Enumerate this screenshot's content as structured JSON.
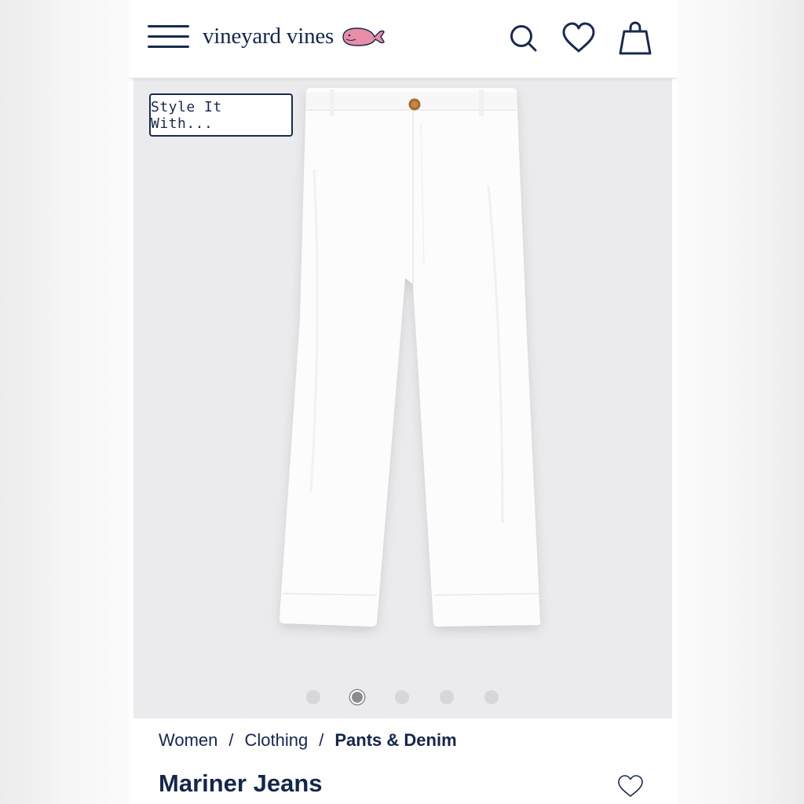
{
  "header": {
    "brand": "vineyard vines",
    "icons": [
      "menu-icon",
      "whale-logo-icon",
      "search-icon",
      "heart-icon",
      "shopping-bag-icon"
    ]
  },
  "gallery": {
    "style_button_label": "Style It With...",
    "dots_total": 5,
    "active_dot_index": 1
  },
  "breadcrumb": {
    "items": [
      "Women",
      "Clothing",
      "Pants & Denim"
    ],
    "separator": "/"
  },
  "product": {
    "title": "Mariner Jeans"
  },
  "colors": {
    "navy": "#16264a",
    "whale_pink": "#e88ea8",
    "image_bg": "#ebebed"
  }
}
